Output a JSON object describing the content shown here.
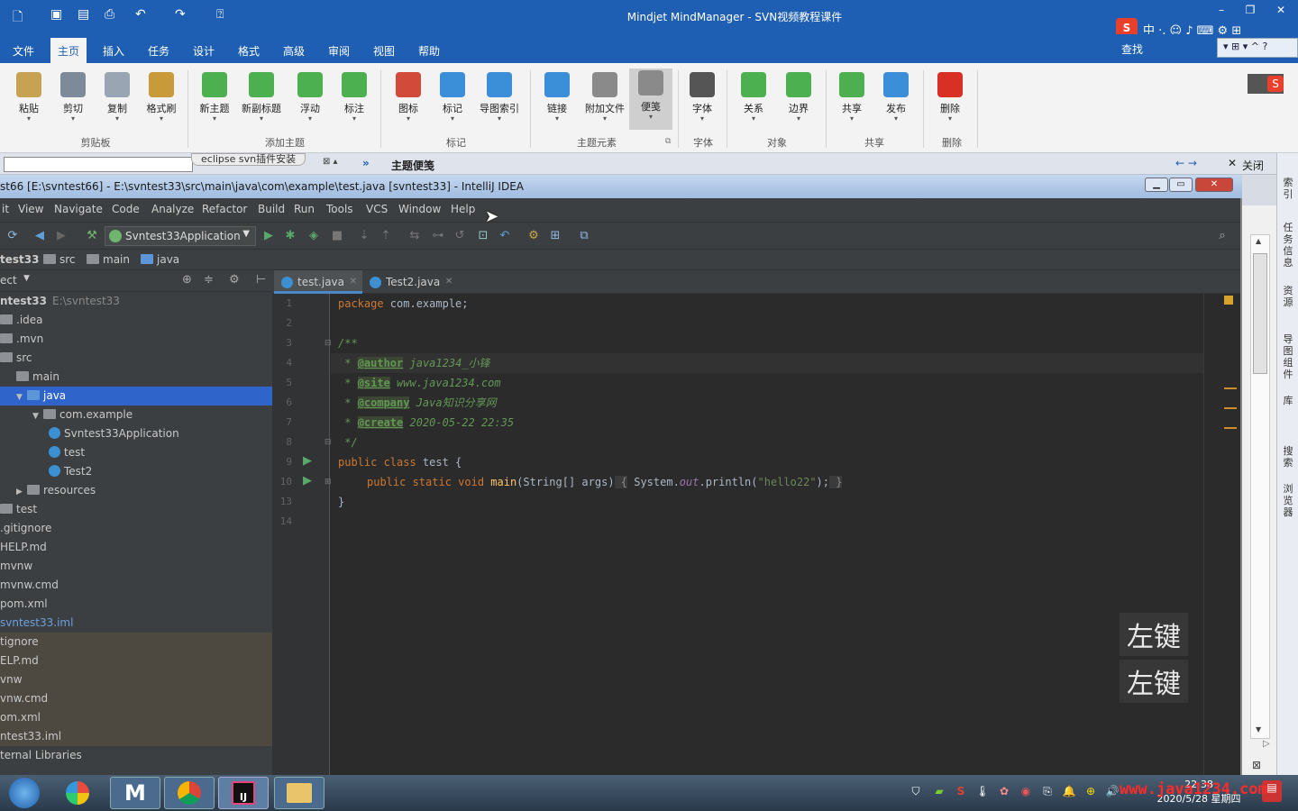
{
  "mindmanager": {
    "title": "Mindjet MindManager - SVN视频教程课件",
    "menu_tabs": [
      "文件",
      "主页",
      "插入",
      "任务",
      "设计",
      "格式",
      "高级",
      "审阅",
      "视图",
      "帮助"
    ],
    "active_tab": "主页",
    "ribbon": {
      "buttons": [
        {
          "label": "粘贴",
          "icon": "paste-icon",
          "color": "#c8a253"
        },
        {
          "label": "剪切",
          "icon": "cut-icon",
          "color": "#7d8a99"
        },
        {
          "label": "复制",
          "icon": "copy-icon",
          "color": "#9aa5b3"
        },
        {
          "label": "格式刷",
          "icon": "format-painter-icon",
          "color": "#c89a3a"
        },
        {
          "label": "新主题",
          "icon": "new-topic-icon",
          "color": "#4caf50"
        },
        {
          "label": "新副标题",
          "icon": "new-subtopic-icon",
          "color": "#4caf50"
        },
        {
          "label": "浮动",
          "icon": "floating-topic-icon",
          "color": "#4caf50"
        },
        {
          "label": "标注",
          "icon": "callout-icon",
          "color": "#4caf50"
        },
        {
          "label": "图标",
          "icon": "icon-marker-icon",
          "color": "#d24a3a"
        },
        {
          "label": "标记",
          "icon": "tag-icon",
          "color": "#3b8ed8"
        },
        {
          "label": "导图索引",
          "icon": "map-index-icon",
          "color": "#3b8ed8"
        },
        {
          "label": "链接",
          "icon": "link-icon",
          "color": "#3b8ed8"
        },
        {
          "label": "附加文件",
          "icon": "attachment-icon",
          "color": "#8a8a8a"
        },
        {
          "label": "便笺",
          "icon": "note-icon",
          "color": "#8a8a8a"
        },
        {
          "label": "字体",
          "icon": "font-icon",
          "color": "#555555"
        },
        {
          "label": "关系",
          "icon": "relationship-icon",
          "color": "#4caf50"
        },
        {
          "label": "边界",
          "icon": "boundary-icon",
          "color": "#4caf50"
        },
        {
          "label": "共享",
          "icon": "share-icon",
          "color": "#4caf50"
        },
        {
          "label": "发布",
          "icon": "publish-icon",
          "color": "#3b8ed8"
        },
        {
          "label": "删除",
          "icon": "delete-icon",
          "color": "#d93025"
        }
      ],
      "groups": [
        "剪贴板",
        "添加主题",
        "标记",
        "主题元素",
        "字体",
        "对象",
        "共享",
        "删除"
      ]
    },
    "search_label": "查找",
    "panel_title": "主题便笺",
    "close_label": "关闭",
    "doc_tab": "eclipse svn插件安装",
    "side_panel": [
      "索引",
      "任务信息",
      "资源",
      "导图组件",
      "库",
      "搜索",
      "浏览器"
    ]
  },
  "intellij": {
    "title": "st66 [E:\\svntest66] - E:\\svntest33\\src\\main\\java\\com\\example\\test.java [svntest33] - IntelliJ IDEA",
    "menu": [
      "it",
      "View",
      "Navigate",
      "Code",
      "Analyze",
      "Refactor",
      "Build",
      "Run",
      "Tools",
      "VCS",
      "Window",
      "Help"
    ],
    "run_config": "Svntest33Application",
    "breadcrumb": [
      "test33",
      "src",
      "main",
      "java"
    ],
    "project_header": "ect",
    "tree": [
      {
        "label": "ntest33",
        "extra": "E:\\svntest33",
        "indent": 0,
        "type": "root"
      },
      {
        "label": ".idea",
        "indent": 0,
        "type": "folder"
      },
      {
        "label": ".mvn",
        "indent": 0,
        "type": "folder"
      },
      {
        "label": "src",
        "indent": 0,
        "type": "folder"
      },
      {
        "label": "main",
        "indent": 1,
        "type": "folder"
      },
      {
        "label": "java",
        "indent": 1,
        "type": "folder-open",
        "selected": true
      },
      {
        "label": "com.example",
        "indent": 2,
        "type": "package"
      },
      {
        "label": "Svntest33Application",
        "indent": 3,
        "type": "class"
      },
      {
        "label": "test",
        "indent": 3,
        "type": "class"
      },
      {
        "label": "Test2",
        "indent": 3,
        "type": "class"
      },
      {
        "label": "resources",
        "indent": 1,
        "type": "folder-closed"
      },
      {
        "label": "test",
        "indent": 0,
        "type": "folder"
      },
      {
        "label": ".gitignore",
        "indent": 0,
        "type": "file"
      },
      {
        "label": "HELP.md",
        "indent": 0,
        "type": "file"
      },
      {
        "label": "mvnw",
        "indent": 0,
        "type": "file"
      },
      {
        "label": "mvnw.cmd",
        "indent": 0,
        "type": "file"
      },
      {
        "label": "pom.xml",
        "indent": 0,
        "type": "file"
      },
      {
        "label": "svntest33.iml",
        "indent": 0,
        "type": "file-blue"
      },
      {
        "label": "tignore",
        "indent": 0,
        "type": "excluded"
      },
      {
        "label": "ELP.md",
        "indent": 0,
        "type": "excluded"
      },
      {
        "label": "vnw",
        "indent": 0,
        "type": "excluded"
      },
      {
        "label": "vnw.cmd",
        "indent": 0,
        "type": "excluded"
      },
      {
        "label": "om.xml",
        "indent": 0,
        "type": "excluded"
      },
      {
        "label": "ntest33.iml",
        "indent": 0,
        "type": "excluded"
      },
      {
        "label": "ternal Libraries",
        "indent": 0,
        "type": "file"
      }
    ],
    "tabs": [
      {
        "label": "test.java",
        "active": true
      },
      {
        "label": "Test2.java",
        "active": false
      }
    ],
    "line_numbers": [
      "1",
      "2",
      "3",
      "4",
      "5",
      "6",
      "7",
      "8",
      "9",
      "10",
      "13",
      "14"
    ],
    "code": {
      "l1_kw": "package",
      "l1_rest": " com.example;",
      "l3": "/**",
      "l4_star": " * ",
      "l4_tag": "@author",
      "l4_text": " java1234_小锋",
      "l5_tag": "@site",
      "l5_text": " www.java1234.com",
      "l6_tag": "@company",
      "l6_text": " Java知识分享网",
      "l7_tag": "@create",
      "l7_text": " 2020-05-22 22:35",
      "l8": " */",
      "l9_kw": "public class",
      "l9_rest": " test {",
      "l10_kw": "public static void",
      "l10_fn": " main",
      "l10_rest": "(String[] args)",
      "l10_brace": " {",
      "l10_body1": " System.",
      "l10_field": "out",
      "l10_body2": ".println(",
      "l10_str": "\"hello22\"",
      "l10_body3": ");",
      "l10_end": " }",
      "l13": "}"
    }
  },
  "overlay": {
    "caption1": "左键",
    "caption2": "左键"
  },
  "taskbar": {
    "time": "22:38",
    "date": "2020/5/28 星期四",
    "watermark": "www.java1234.com"
  }
}
